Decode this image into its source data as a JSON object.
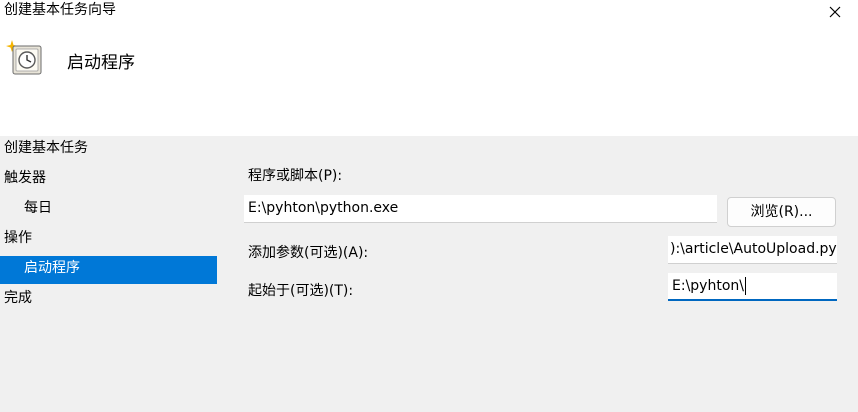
{
  "window": {
    "title": "创建基本任务向导",
    "close_icon": "close-icon"
  },
  "header": {
    "icon": "task-clock-icon",
    "title": "启动程序"
  },
  "steps": [
    {
      "label": "创建基本任务",
      "indent": false,
      "selected": false
    },
    {
      "label": "触发器",
      "indent": false,
      "selected": false
    },
    {
      "label": "每日",
      "indent": true,
      "selected": false
    },
    {
      "label": "操作",
      "indent": false,
      "selected": false
    },
    {
      "label": "启动程序",
      "indent": true,
      "selected": true
    },
    {
      "label": "完成",
      "indent": false,
      "selected": false
    }
  ],
  "form": {
    "program_label": "程序或脚本(P):",
    "program_value": "E:\\pyhton\\python.exe",
    "browse_label": "浏览(R)...",
    "args_label": "添加参数(可选)(A):",
    "args_value_visible": "):\\article\\AutoUpload.py",
    "start_label": "起始于(可选)(T):",
    "start_value": "E:\\pyhton\\"
  },
  "colors": {
    "selected_bg": "#0078d7",
    "focus_border": "#0067c0"
  }
}
